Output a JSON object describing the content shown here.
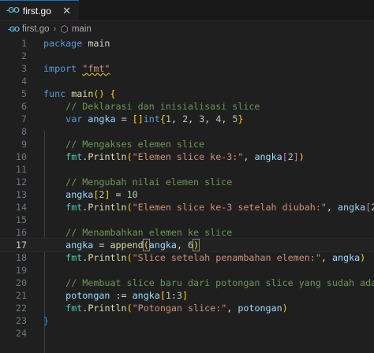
{
  "tab": {
    "label": "first.go",
    "close": "✕"
  },
  "breadcrumb": {
    "file": "first.go",
    "separator": "›",
    "symbol": "main"
  },
  "lines": [
    {
      "n": "1",
      "text": "package main"
    },
    {
      "n": "2",
      "text": ""
    },
    {
      "n": "3",
      "text": "import \"fmt\""
    },
    {
      "n": "4",
      "text": ""
    },
    {
      "n": "5",
      "text": "func main() {"
    },
    {
      "n": "6",
      "text": "    // Deklarasi dan inisialisasi slice"
    },
    {
      "n": "7",
      "text": "    var angka = []int{1, 2, 3, 4, 5}"
    },
    {
      "n": "8",
      "text": ""
    },
    {
      "n": "9",
      "text": "    // Mengakses elemen slice"
    },
    {
      "n": "10",
      "text": "    fmt.Println(\"Elemen slice ke-3:\", angka[2])"
    },
    {
      "n": "11",
      "text": ""
    },
    {
      "n": "12",
      "text": "    // Mengubah nilai elemen slice"
    },
    {
      "n": "13",
      "text": "    angka[2] = 10"
    },
    {
      "n": "14",
      "text": "    fmt.Println(\"Elemen slice ke-3 setelah diubah:\", angka[2])"
    },
    {
      "n": "15",
      "text": ""
    },
    {
      "n": "16",
      "text": "    // Menambahkan elemen ke slice"
    },
    {
      "n": "17",
      "text": "    angka = append(angka, 6)"
    },
    {
      "n": "18",
      "text": "    fmt.Println(\"Slice setelah penambahan elemen:\", angka)"
    },
    {
      "n": "19",
      "text": ""
    },
    {
      "n": "20",
      "text": "    // Membuat slice baru dari potongan slice yang sudah ada"
    },
    {
      "n": "21",
      "text": "    potongan := angka[1:3]"
    },
    {
      "n": "22",
      "text": "    fmt.Println(\"Potongan slice:\", potongan)"
    },
    {
      "n": "23",
      "text": "}"
    },
    {
      "n": "24",
      "text": ""
    }
  ],
  "active_line": "17",
  "colors": {
    "keyword": "#569cd6",
    "control": "#c586c0",
    "function": "#dcdcaa",
    "variable": "#9cdcfe",
    "string": "#ce9178",
    "number": "#b5cea8",
    "comment": "#6a9955",
    "background": "#1f1f1f"
  },
  "icons": {
    "file": "go-file-icon",
    "symbol": "method-cube-icon"
  }
}
